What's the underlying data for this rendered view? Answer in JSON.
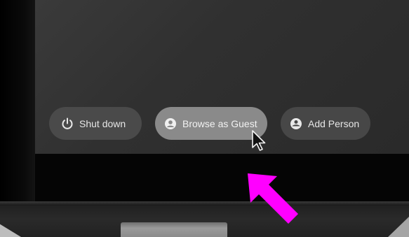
{
  "shelf": {
    "shutdown_label": "Shut down",
    "guest_label": "Browse as Guest",
    "add_person_label": "Add Person"
  },
  "icons": {
    "shutdown": "power-icon",
    "guest": "guest-account-icon",
    "add_person": "add-person-icon",
    "cursor": "mouse-pointer-icon",
    "annotation": "arrow-annotation-icon"
  },
  "colors": {
    "annotation_arrow": "#ff00ff",
    "guest_button_highlight": "#8a8a8a"
  }
}
